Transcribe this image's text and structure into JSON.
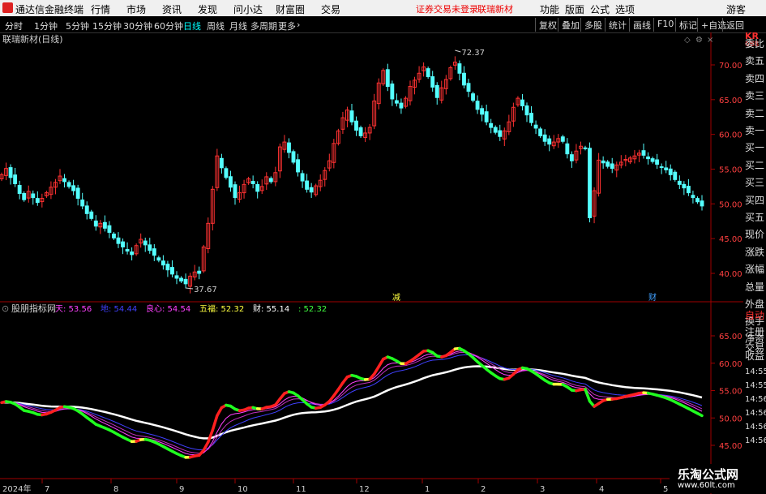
{
  "menu": {
    "app_title": "通达信金融终端",
    "items": [
      "行情",
      "市场",
      "资讯",
      "发现",
      "问小达",
      "财富圈",
      "交易"
    ],
    "status": "证券交易未登录",
    "stock": "联瑞新材",
    "right_items": [
      "功能",
      "版面",
      "公式",
      "选项"
    ],
    "guest": "游客"
  },
  "periods": [
    "分时",
    "1分钟",
    "5分钟",
    "15分钟",
    "30分钟",
    "60分钟",
    "日线",
    "周线",
    "月线",
    "多周期",
    "更多"
  ],
  "active_period": "日线",
  "toolbar": [
    "复权",
    "叠加",
    "多股",
    "统计",
    "画线",
    "F10",
    "标记",
    "+自选",
    "返回"
  ],
  "main_chart": {
    "title": "联瑞新材(日线)",
    "high_label": "72.37",
    "low_label": "37.67",
    "markers": [
      "减",
      "财"
    ],
    "y_ticks": [
      "70.00",
      "65.00",
      "60.00",
      "55.00",
      "50.00",
      "45.00",
      "40.00"
    ]
  },
  "indicator": {
    "name": "股朋指标网",
    "values": [
      {
        "label": "天",
        "value": "53.56",
        "color": "#ff40ff"
      },
      {
        "label": "地",
        "value": "54.44",
        "color": "#4040ff"
      },
      {
        "label": "良心",
        "value": "54.54",
        "color": "#ff40ff"
      },
      {
        "label": "五福",
        "value": "52.32",
        "color": "#ffff40"
      },
      {
        "label": "财",
        "value": "55.14",
        "color": "#ffffff"
      },
      {
        "label": "",
        "value": "52.32",
        "color": "#40ff40"
      }
    ],
    "y_ticks": [
      "65.00",
      "60.00",
      "55.00",
      "50.00",
      "45.00"
    ]
  },
  "x_axis": {
    "year": "2024年",
    "months": [
      "7",
      "8",
      "9",
      "10",
      "11",
      "12",
      "1",
      "2",
      "3",
      "4",
      "5"
    ]
  },
  "right_panel": {
    "stock_code": "KR",
    "stock_sub": "688",
    "items": [
      "委比",
      "卖五",
      "卖四",
      "卖三",
      "卖二",
      "卖一",
      "买一",
      "买二",
      "买三",
      "买四",
      "买五",
      "现价",
      "涨跌",
      "涨幅",
      "总量",
      "外盘",
      "换手",
      "净资",
      "收益",
      "自动",
      "注册",
      "交易"
    ],
    "times": [
      "14:55",
      "14:55",
      "14:56",
      "14:56",
      "14:56",
      "14:56"
    ]
  },
  "watermark": {
    "name": "乐淘公式网",
    "url": "www.60lt.com"
  },
  "chart_data": [
    {
      "type": "candlestick",
      "title": "联瑞新材(日线)",
      "ylim": [
        37,
        75
      ],
      "x_labels": [
        "7",
        "8",
        "9",
        "10",
        "11",
        "12",
        "1",
        "2",
        "3",
        "4",
        "5"
      ],
      "annotations": [
        {
          "text": "72.37",
          "kind": "max"
        },
        {
          "text": "37.67",
          "kind": "min"
        }
      ],
      "close": [
        54.2,
        55.1,
        53.8,
        52.9,
        51.5,
        50.6,
        51.8,
        50.9,
        50.2,
        50.8,
        51.6,
        52.4,
        53.1,
        54.0,
        53.2,
        52.5,
        51.9,
        50.8,
        49.7,
        48.6,
        47.9,
        46.8,
        47.2,
        46.5,
        45.9,
        45.1,
        44.3,
        43.8,
        43.2,
        42.7,
        44.0,
        44.9,
        44.1,
        43.3,
        42.6,
        41.9,
        41.2,
        40.5,
        39.9,
        39.3,
        38.9,
        38.5,
        39.6,
        40.2,
        40.0,
        43.8,
        47.2,
        52.1,
        56.9,
        55.2,
        53.8,
        52.4,
        50.9,
        51.6,
        52.8,
        53.6,
        52.9,
        51.8,
        52.5,
        53.9,
        53.2,
        54.5,
        58.2,
        58.9,
        57.4,
        56.0,
        54.6,
        53.3,
        52.1,
        51.7,
        52.6,
        53.4,
        54.8,
        56.2,
        58.7,
        60.5,
        62.4,
        63.5,
        61.8,
        60.6,
        59.8,
        60.2,
        61.0,
        64.8,
        67.4,
        69.2,
        66.9,
        65.1,
        64.5,
        63.8,
        65.2,
        66.9,
        67.8,
        68.8,
        69.7,
        68.3,
        66.8,
        65.3,
        66.7,
        67.9,
        69.6,
        70.4,
        68.8,
        67.1,
        66.2,
        64.9,
        63.6,
        62.9,
        61.8,
        61.0,
        60.3,
        59.7,
        60.5,
        61.8,
        63.9,
        65.2,
        64.1,
        62.8,
        61.7,
        60.9,
        59.8,
        59.0,
        58.6,
        58.9,
        59.4,
        59.0,
        57.2,
        56.2,
        57.6,
        58.3,
        58.0,
        48.0,
        51.9,
        56.3,
        55.9,
        55.4,
        55.1,
        55.6,
        56.0,
        56.4,
        56.6,
        56.9,
        57.3,
        57.0,
        56.5,
        56.1,
        55.7,
        55.3,
        54.9,
        54.2,
        53.5,
        52.8,
        52.3,
        51.6,
        50.9,
        50.3,
        49.7
      ],
      "series_note": ""
    },
    {
      "type": "line",
      "title": "股朋指标网",
      "ylim": [
        42,
        69
      ],
      "series": [
        {
          "name": "天",
          "values": [
            53.56
          ]
        },
        {
          "name": "地",
          "values": [
            54.44
          ]
        },
        {
          "name": "良心",
          "values": [
            54.54
          ]
        },
        {
          "name": "五福",
          "values": [
            52.32
          ]
        },
        {
          "name": "财",
          "values": [
            55.14
          ]
        }
      ]
    }
  ]
}
